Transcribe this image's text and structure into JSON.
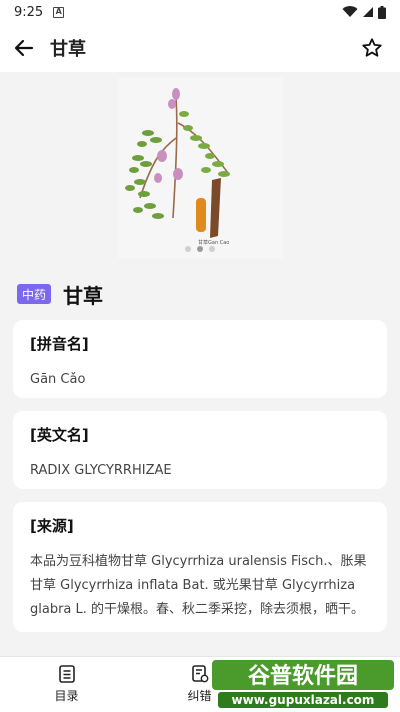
{
  "status_bar": {
    "time": "9:25"
  },
  "app_bar": {
    "title": "甘草",
    "back_icon": "arrow-left-icon",
    "favorite_icon": "star-outline-icon"
  },
  "hero": {
    "image": "licorice-plant-illustration",
    "caption": "甘草Gan Cao",
    "slide_count": 3,
    "active_slide": 2
  },
  "herb": {
    "badge": "中药",
    "name": "甘草"
  },
  "sections": [
    {
      "label": "[拼音名]",
      "value": "Gān Cǎo"
    },
    {
      "label": "[英文名]",
      "value": "RADIX GLYCYRRHIZAE"
    },
    {
      "label": "[来源]",
      "value": "本品为豆科植物甘草 Glycyrrhiza uralensis Fisch.、胀果甘草 Glycyrrhiza inflata Bat. 或光果甘草 Glycyrrhiza glabra L. 的干燥根。春、秋二季采挖，除去须根，晒干。"
    }
  ],
  "bottom_nav": [
    {
      "label": "目录",
      "icon": "list-icon"
    },
    {
      "label": "纠错",
      "icon": "edit-doc-icon"
    }
  ],
  "watermark": {
    "line1": "谷普软件园",
    "line2": "www.gupuxlazal.com"
  },
  "colors": {
    "badge": "#7b68ee",
    "background": "#f3f3f3",
    "card": "#ffffff"
  }
}
